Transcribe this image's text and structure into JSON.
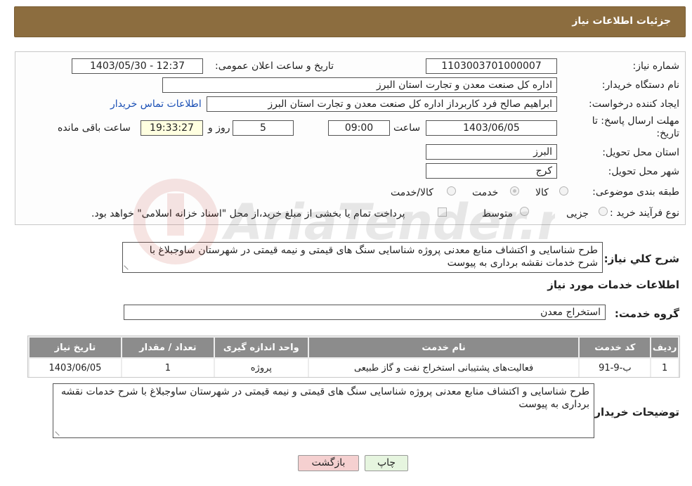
{
  "page": {
    "title": "جزئیات اطلاعات نیاز"
  },
  "fields": {
    "need_number_label": "شماره نیاز:",
    "need_number": "1103003701000007",
    "announce_label": "تاریخ و ساعت اعلان عمومی:",
    "announce_value": "1403/05/30 - 12:37",
    "buyer_org_label": "نام دستگاه خریدار:",
    "buyer_org": "اداره کل صنعت  معدن و تجارت استان البرز",
    "creator_label": "ایجاد کننده درخواست:",
    "creator": "ابراهیم صالح فرد کاربرداز اداره کل صنعت  معدن و تجارت استان البرز",
    "contact_link": "اطلاعات تماس خریدار",
    "deadline_label_1": "مهلت ارسال پاسخ: تا",
    "deadline_label_2": "تاریخ:",
    "deadline_date": "1403/06/05",
    "time_label": "ساعت",
    "deadline_time": "09:00",
    "days": "5",
    "days_label": "روز و",
    "remaining": "19:33:27",
    "remaining_label": "ساعت باقی مانده",
    "province_label": "استان محل تحویل:",
    "province": "البرز",
    "city_label": "شهر محل تحویل:",
    "city": "کرج",
    "category_label": "طبقه بندی موضوعی:",
    "category_options": [
      "کالا",
      "خدمت",
      "کالا/خدمت"
    ],
    "category_selected": "خدمت",
    "process_label": "نوع فرآیند خرید :",
    "process_options": [
      "جزیی",
      "متوسط"
    ],
    "payment_note": "پرداخت تمام یا بخشی از مبلغ خرید،از محل \"اسناد خزانه اسلامی\" خواهد بود."
  },
  "summary": {
    "label": "شرح کلي نياز:",
    "text": "طرح شناسایی و اکتشاف منابع معدنی پروژه شناسایی سنگ های قیمتی و نیمه قیمتی در شهرستان ساوجبلاغ با شرح خدمات نقشه برداری به پیوست"
  },
  "services": {
    "section_title": "اطلاعات خدمات مورد نياز",
    "group_label": "گروه خدمت:",
    "group_value": "استخراج معدن",
    "columns": [
      "رديف",
      "کد خدمت",
      "نام خدمت",
      "واحد اندازه گیری",
      "تعداد / مقدار",
      "تاریخ نیاز"
    ],
    "rows": [
      [
        "1",
        "ب-9-91",
        "فعالیت‌های پشتیبانی استخراج نفت و گاز طبیعی",
        "پروژه",
        "1",
        "1403/06/05"
      ]
    ]
  },
  "buyer_notes": {
    "label": "توضیحات خریدار:",
    "text": "طرح شناسایی و اکتشاف منابع معدنی پروژه شناسایی سنگ های قیمتی و نیمه قیمتی در شهرستان ساوجبلاغ با شرح خدمات نقشه برداری به پیوست"
  },
  "buttons": {
    "print": "چاپ",
    "back": "بازگشت"
  },
  "watermark": {
    "text": "AriaTender.neT"
  },
  "colors": {
    "header": "#8c6d3f",
    "table_header": "#8c8c8c",
    "link": "#1a4fb5"
  }
}
